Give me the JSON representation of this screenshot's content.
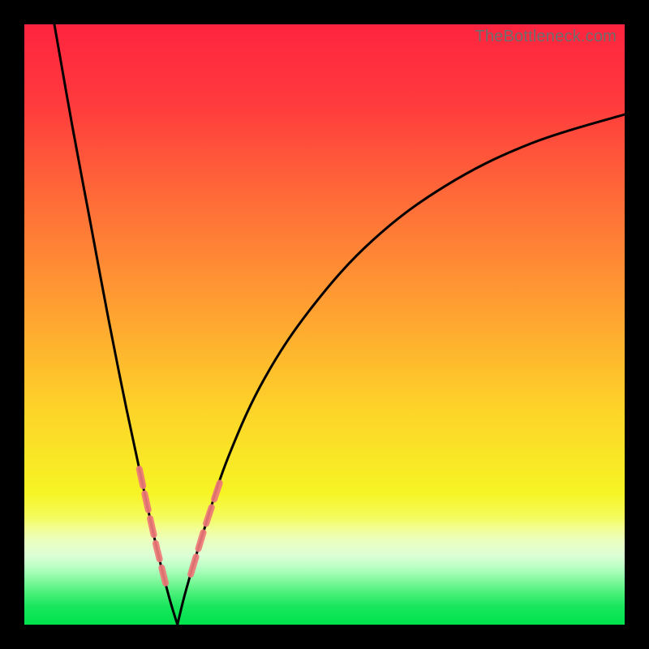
{
  "watermark": "TheBottleneck.com",
  "colors": {
    "frame_bg": "#000000",
    "gradient_stops": [
      {
        "offset": 0.0,
        "color": "#ff243f"
      },
      {
        "offset": 0.13,
        "color": "#ff3a3d"
      },
      {
        "offset": 0.3,
        "color": "#ff6e38"
      },
      {
        "offset": 0.48,
        "color": "#ffa231"
      },
      {
        "offset": 0.64,
        "color": "#fdd329"
      },
      {
        "offset": 0.78,
        "color": "#f6f424"
      },
      {
        "offset": 0.82,
        "color": "#f5fb5a"
      },
      {
        "offset": 0.84,
        "color": "#f2fe94"
      },
      {
        "offset": 0.86,
        "color": "#eaffc0"
      },
      {
        "offset": 0.885,
        "color": "#dcffd6"
      },
      {
        "offset": 0.905,
        "color": "#b8ffc4"
      },
      {
        "offset": 0.925,
        "color": "#85f9a0"
      },
      {
        "offset": 0.945,
        "color": "#4ff17d"
      },
      {
        "offset": 0.97,
        "color": "#18e65c"
      },
      {
        "offset": 1.0,
        "color": "#00e24e"
      }
    ],
    "curve_stroke": "#000000",
    "dash_stroke": "rgba(239,120,120,0.92)"
  },
  "chart_data": {
    "type": "line",
    "title": "",
    "xlabel": "",
    "ylabel": "",
    "xlim": [
      0,
      100
    ],
    "ylim": [
      0,
      100
    ],
    "grid": false,
    "axes_visible": false,
    "description": "Vertical gradient background (red at top through orange/yellow to green at bottom). Two thin black curves form a sharp V with minimum near x≈25, y≈0; left branch rises steeply to top-left corner, right branch rises with diminishing slope toward upper right. Short salmon-pink dashed segments overlay the curves near y=10–25% (the yellow band).",
    "series": [
      {
        "name": "left_branch",
        "x": [
          5,
          8,
          11,
          14,
          17,
          20,
          22,
          24,
          25.5
        ],
        "y": [
          100,
          83,
          67,
          51,
          36,
          22,
          13,
          5,
          0
        ]
      },
      {
        "name": "right_branch",
        "x": [
          25.5,
          27,
          30,
          34,
          40,
          48,
          58,
          70,
          84,
          100
        ],
        "y": [
          0,
          6,
          16,
          28,
          41,
          53,
          64,
          73,
          80,
          85
        ]
      }
    ],
    "dash_segments_y_range": [
      8,
      26
    ]
  }
}
